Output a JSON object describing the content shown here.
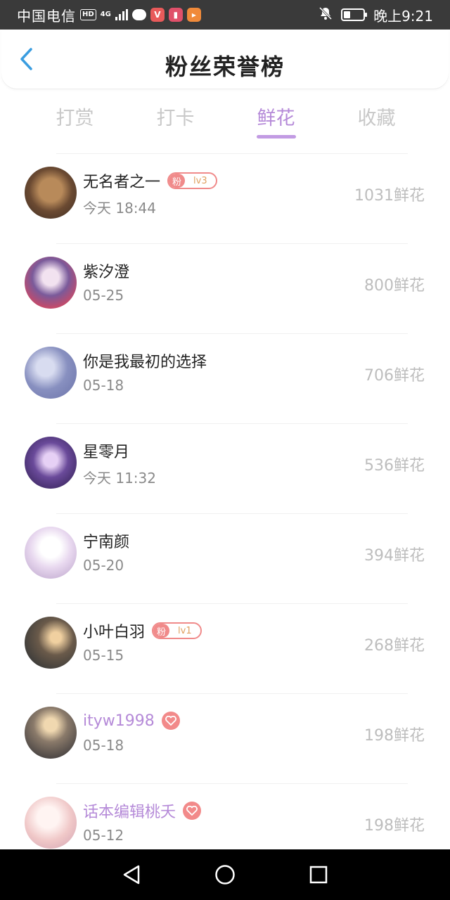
{
  "status_bar": {
    "carrier": "中国电信",
    "hd_badge": "HD",
    "network": "4G",
    "time": "晚上9:21",
    "battery_level": 0.35
  },
  "header": {
    "title": "粉丝荣誉榜",
    "back_icon": "chevron-left-icon"
  },
  "tabs": [
    {
      "label": "打赏",
      "active": false
    },
    {
      "label": "打卡",
      "active": false
    },
    {
      "label": "鲜花",
      "active": true
    },
    {
      "label": "收藏",
      "active": false
    }
  ],
  "colors": {
    "accent": "#b58ad8",
    "fan_badge": "#f08a8a",
    "amount": "#bdbdbd"
  },
  "fans": [
    {
      "name": "无名者之一",
      "time": "今天 18:44",
      "amount": "1031鲜花",
      "badge": {
        "type": "fan",
        "left": "粉",
        "level": "lv3"
      },
      "vip": false
    },
    {
      "name": "紫汐澄",
      "time": "05-25",
      "amount": "800鲜花",
      "badge": null,
      "vip": false
    },
    {
      "name": "你是我最初的选择",
      "time": "05-18",
      "amount": "706鲜花",
      "badge": null,
      "vip": false
    },
    {
      "name": "星零月",
      "time": "今天 11:32",
      "amount": "536鲜花",
      "badge": null,
      "vip": false
    },
    {
      "name": "宁南颜",
      "time": "05-20",
      "amount": "394鲜花",
      "badge": null,
      "vip": false
    },
    {
      "name": "小叶白羽",
      "time": "05-15",
      "amount": "268鲜花",
      "badge": {
        "type": "fan",
        "left": "粉",
        "level": "lv1"
      },
      "vip": false
    },
    {
      "name": "ityw1998",
      "time": "05-18",
      "amount": "198鲜花",
      "badge": {
        "type": "heart"
      },
      "vip": true
    },
    {
      "name": "话本编辑桃夭",
      "time": "05-12",
      "amount": "198鲜花",
      "badge": {
        "type": "heart"
      },
      "vip": true
    }
  ],
  "nav": [
    "back-triangle-icon",
    "home-circle-icon",
    "recents-square-icon"
  ]
}
